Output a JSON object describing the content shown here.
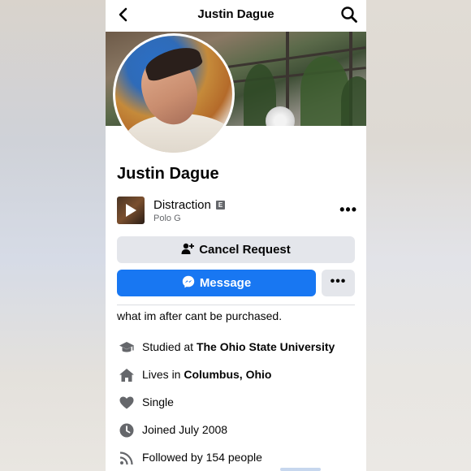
{
  "header": {
    "title": "Justin Dague",
    "back_icon": "back-arrow-icon",
    "search_icon": "search-icon"
  },
  "profile": {
    "name": "Justin Dague"
  },
  "song": {
    "title": "Distraction",
    "explicit_badge": "E",
    "artist": "Polo G",
    "more_label": "•••"
  },
  "actions": {
    "cancel_request_label": "Cancel Request",
    "message_label": "Message",
    "more_label": "•••"
  },
  "bio": "what im after cant be purchased.",
  "details": [
    {
      "icon": "graduation-cap-icon",
      "prefix": "Studied at ",
      "bold": "The Ohio State University"
    },
    {
      "icon": "home-icon",
      "prefix": "Lives in ",
      "bold": "Columbus, Ohio"
    },
    {
      "icon": "heart-icon",
      "prefix": "Single",
      "bold": ""
    },
    {
      "icon": "clock-icon",
      "prefix": "Joined July 2008",
      "bold": ""
    },
    {
      "icon": "rss-icon",
      "prefix": "Followed by 154 people",
      "bold": ""
    }
  ],
  "colors": {
    "primary": "#1877f2",
    "secondary_button": "#e4e6eb",
    "text": "#050505",
    "muted": "#65676b",
    "icon": "#65676b"
  }
}
